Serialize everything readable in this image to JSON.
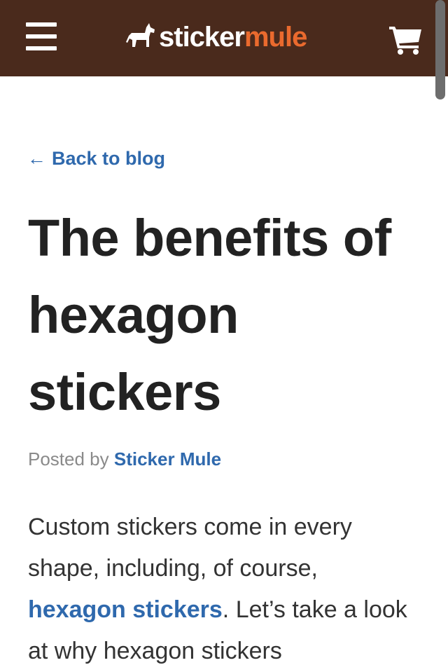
{
  "header": {
    "logo_word1": "sticker",
    "logo_word2": "mule",
    "bg_color": "#4a2a1c",
    "accent_color": "#ea6a2e"
  },
  "icons": {
    "menu": "hamburger-menu-icon",
    "logo": "mule-icon",
    "cart": "shopping-cart-icon"
  },
  "nav": {
    "back_arrow": "←",
    "back_label": "Back to blog"
  },
  "article": {
    "title": "The benefits of hexagon stickers",
    "byline_prefix": "Posted by",
    "author": "Sticker Mule",
    "intro_part1": "Custom stickers come in every shape, including, of course, ",
    "intro_link": "hexagon stickers",
    "intro_part2": ". Let’s take a look at why hexagon stickers"
  },
  "colors": {
    "link": "#2f69ad",
    "title": "#222222",
    "body": "#333333",
    "muted": "#8a8a8a"
  }
}
